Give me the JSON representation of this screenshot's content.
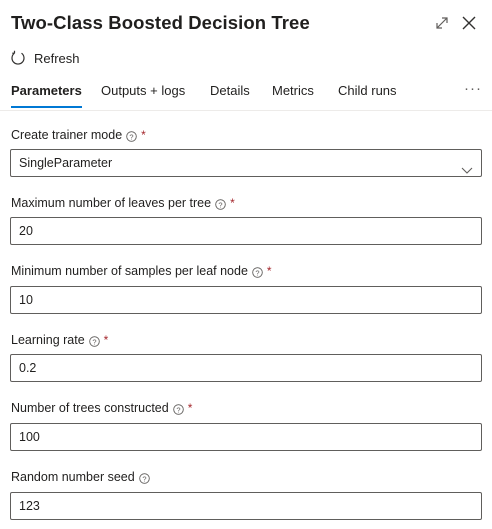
{
  "panel": {
    "title": "Two-Class Boosted Decision Tree",
    "refresh_label": "Refresh"
  },
  "tabs": [
    {
      "label": "Parameters",
      "active": true
    },
    {
      "label": "Outputs + logs",
      "active": false
    },
    {
      "label": "Details",
      "active": false
    },
    {
      "label": "Metrics",
      "active": false
    },
    {
      "label": "Child runs",
      "active": false
    }
  ],
  "more_label": "···",
  "fields": {
    "trainer_mode": {
      "label": "Create trainer mode",
      "required": "*",
      "value": "SingleParameter"
    },
    "max_leaves": {
      "label": "Maximum number of leaves per tree",
      "required": "*",
      "value": "20"
    },
    "min_samples": {
      "label": "Minimum number of samples per leaf node",
      "required": "*",
      "value": "10"
    },
    "learning_rate": {
      "label": "Learning rate",
      "required": "*",
      "value": "0.2"
    },
    "num_trees": {
      "label": "Number of trees constructed",
      "required": "*",
      "value": "100"
    },
    "random_seed": {
      "label": "Random number seed",
      "value": "123"
    }
  },
  "colors": {
    "accent": "#0078d4",
    "required": "#a4262c",
    "border": "#605e5c"
  }
}
